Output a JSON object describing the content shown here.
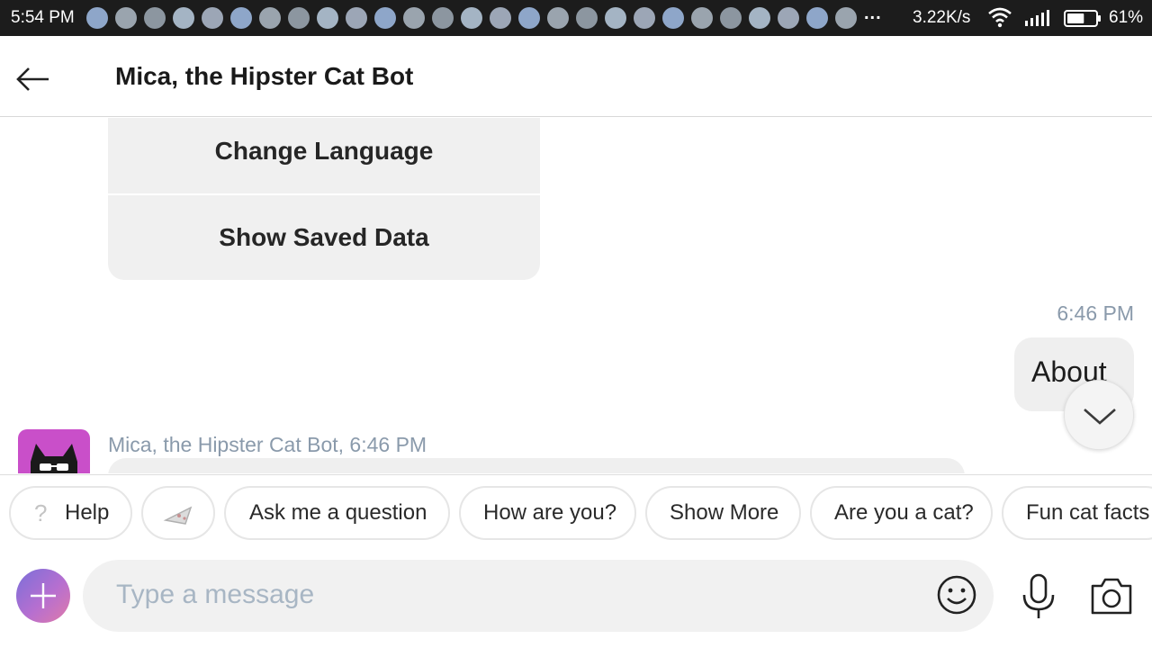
{
  "status_bar": {
    "time": "5:54 PM",
    "notification_icons": [
      "messenger-icon",
      "momo-icon",
      "momo-icon",
      "telegram-icon",
      "viber-icon",
      "email-icon",
      "maps-icon",
      "momo-icon",
      "momo-icon",
      "circle-app-icon",
      "momo-icon",
      "messenger-icon",
      "email-icon",
      "messenger-icon",
      "cloud-icon",
      "maps-icon",
      "messenger-icon",
      "pinterest-icon",
      "chat-bubble-icon",
      "sim-icon",
      "pinterest-icon",
      "boat-icon",
      "messenger-icon",
      "messenger-icon",
      "facebook-icon",
      "messenger-icon",
      "boat-icon"
    ],
    "more_indicator": "...",
    "network_speed": "3.22K/s",
    "battery_percent": "61%",
    "battery_level": 0.61
  },
  "header": {
    "title": "Mica, the Hipster Cat Bot"
  },
  "chat": {
    "menu_items": [
      "Change Language",
      "Show Saved Data"
    ],
    "user_message": {
      "time": "6:46 PM",
      "text": "About"
    },
    "bot_message": {
      "meta": "Mica, the Hipster Cat Bot, 6:46 PM"
    }
  },
  "quick_replies": {
    "help": "Help",
    "items": [
      "Ask me a question",
      "How are you?",
      "Show More",
      "Are you a cat?",
      "Fun cat facts"
    ]
  },
  "composer": {
    "placeholder": "Type a message"
  },
  "colors": {
    "status_bar_bg": "#1c1c1c",
    "bubble_bg": "#efefef",
    "meta_text": "#8a9aab",
    "avatar_bg": "#c94fc9",
    "placeholder": "#a8b6c4"
  }
}
